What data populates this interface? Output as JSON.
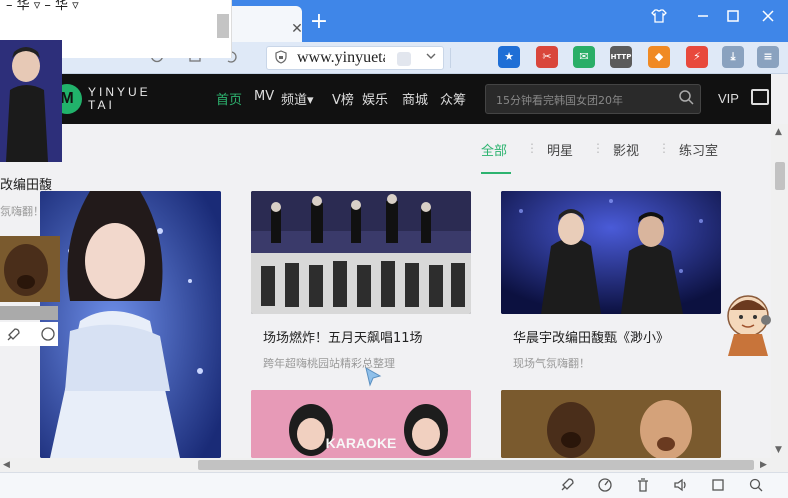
{
  "browser": {
    "new_tab": "+",
    "url": "www.yinyuetai.com",
    "close_tab": "✕",
    "win_buttons": [
      "👕",
      "—",
      "☐",
      "✕"
    ],
    "extensions": [
      {
        "name": "bookmark-star-icon",
        "color": "#1f6fd6",
        "glyph": "★"
      },
      {
        "name": "screenshot-icon",
        "color": "#d9463b",
        "glyph": "✂"
      },
      {
        "name": "wechat-icon",
        "color": "#2aae67",
        "glyph": "✉"
      },
      {
        "name": "http-icon",
        "color": "#5b5b5b",
        "glyph": "HTTP"
      },
      {
        "name": "shield-ext-icon",
        "color": "#f08a24",
        "glyph": "◆"
      },
      {
        "name": "lightning-icon",
        "color": "#e8493c",
        "glyph": "⚡"
      },
      {
        "name": "download-icon",
        "color": "#8aa2bf",
        "glyph": "⤓"
      },
      {
        "name": "menu-icon",
        "color": "#8aa2bf",
        "glyph": "≡"
      }
    ]
  },
  "site": {
    "logo_line1": "YINYUE",
    "logo_line2": "TAI",
    "menu": [
      "首页",
      "MV",
      "频道▾",
      "V榜",
      "娱乐",
      "商城",
      "众筹"
    ],
    "search_placeholder": "15分钟看完韩国女团20年",
    "vip": "VIP",
    "filters": [
      "全部",
      "明星",
      "影视",
      "练习室"
    ],
    "cards": [
      {
        "title": "场场燃炸！五月天飙唱11场",
        "subtitle": "跨年超嗨桃园站精彩总整理"
      },
      {
        "title": "华晨宇改编田馥甄《渺小》",
        "subtitle": "现场气氛嗨翻！"
      }
    ]
  },
  "ghost": {
    "top_text": "– 华 ▿ – 华 ▿",
    "title": "改编田馥",
    "subtitle": "氛嗨翻！"
  }
}
